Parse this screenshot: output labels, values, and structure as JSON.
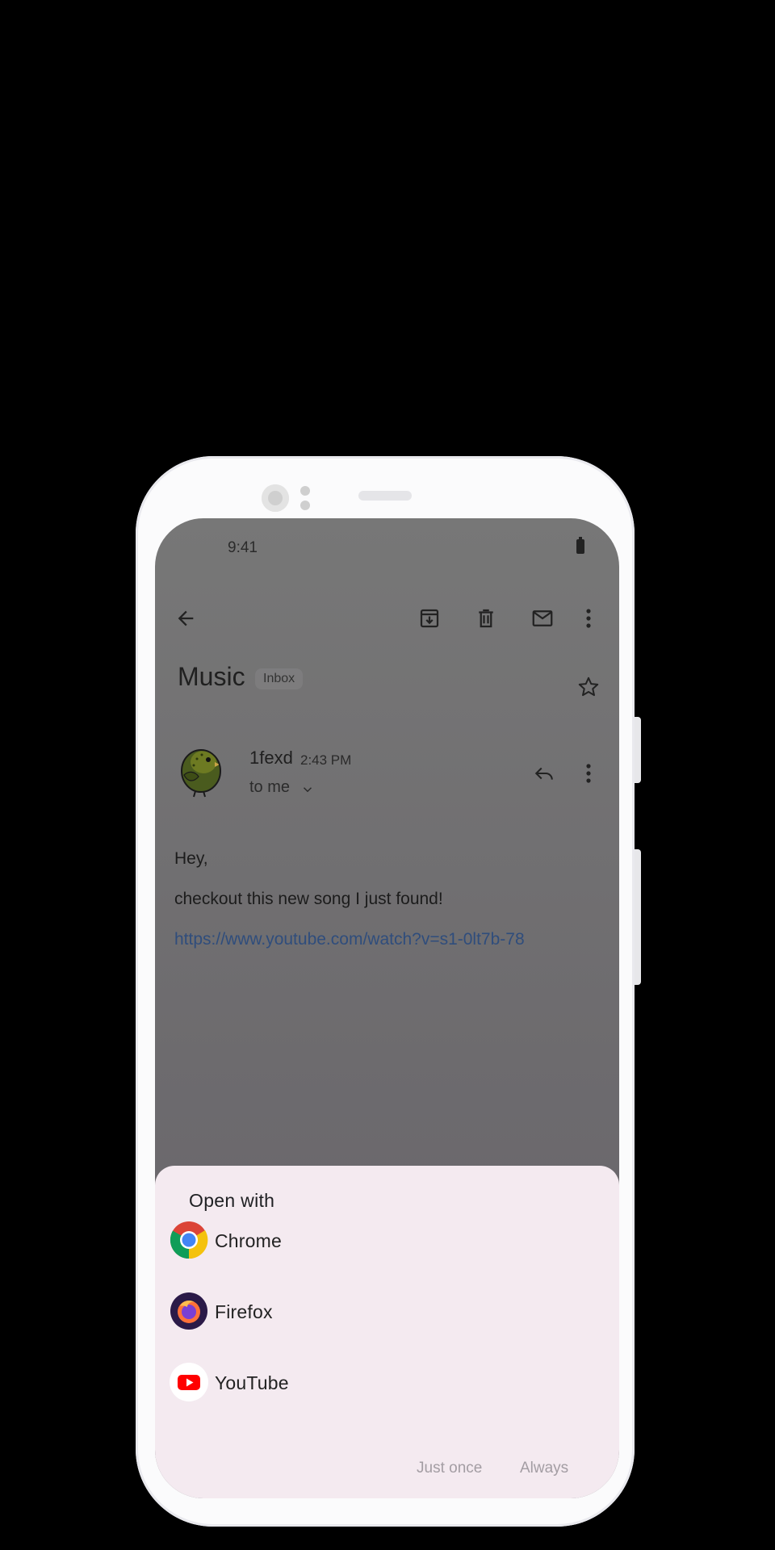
{
  "status": {
    "time": "9:41"
  },
  "toolbar": {
    "back_icon": "arrow-back-icon",
    "archive_icon": "archive-icon",
    "delete_icon": "trash-icon",
    "mark_unread_icon": "mail-icon",
    "more_icon": "more-vert-icon"
  },
  "email": {
    "subject": "Music",
    "label_chip": "Inbox",
    "star_icon": "star-outline-icon",
    "sender": "1fexd",
    "time": "2:43 PM",
    "recipient": "to me",
    "reply_icon": "reply-icon",
    "more_icon": "more-vert-icon",
    "body": {
      "greeting": "Hey,",
      "line": "checkout this new song I just found!",
      "link": "https://www.youtube.com/watch?v=s1-0lt7b-78"
    }
  },
  "chooser": {
    "title": "Open with",
    "apps": [
      {
        "label": "Chrome",
        "icon": "chrome-icon"
      },
      {
        "label": "Firefox",
        "icon": "firefox-icon"
      },
      {
        "label": "YouTube",
        "icon": "youtube-icon"
      }
    ],
    "just_once_label": "Just once",
    "always_label": "Always"
  },
  "colors": {
    "sheet_bg": "#f4eaf0",
    "link": "#2f4d7c",
    "dim_overlay": "#6f6d70",
    "button_text_disabled": "#a39da3"
  }
}
